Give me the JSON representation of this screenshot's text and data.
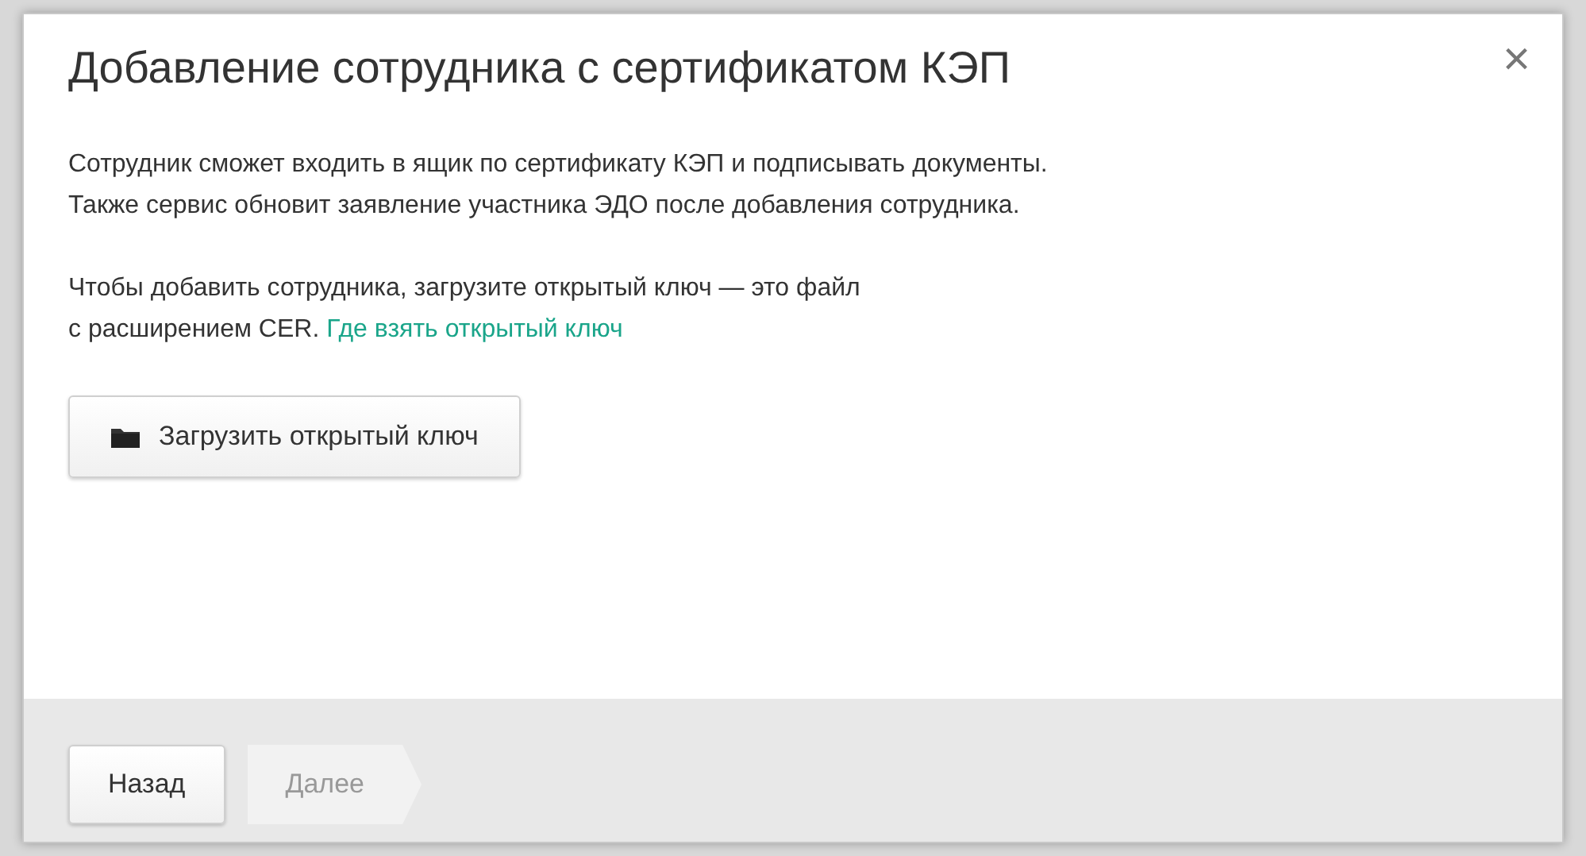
{
  "dialog": {
    "title": "Добавление сотрудника с сертификатом КЭП",
    "close": "×",
    "paragraphs": [
      {
        "lines": [
          "Сотрудник сможет входить в ящик по сертификату КЭП и подписывать документы.",
          "Также сервис обновит заявление участника ЭДО после добавления сотрудника."
        ]
      },
      {
        "lines": [
          "Чтобы добавить сотрудника, загрузите открытый ключ — это файл",
          "с расширением CER."
        ],
        "link": "Где взять открытый ключ"
      }
    ],
    "upload_button": "Загрузить открытый ключ",
    "footer": [
      {
        "label": "Назад",
        "kind": "back",
        "disabled": false
      },
      {
        "label": "Далее",
        "kind": "next",
        "disabled": true
      }
    ]
  }
}
